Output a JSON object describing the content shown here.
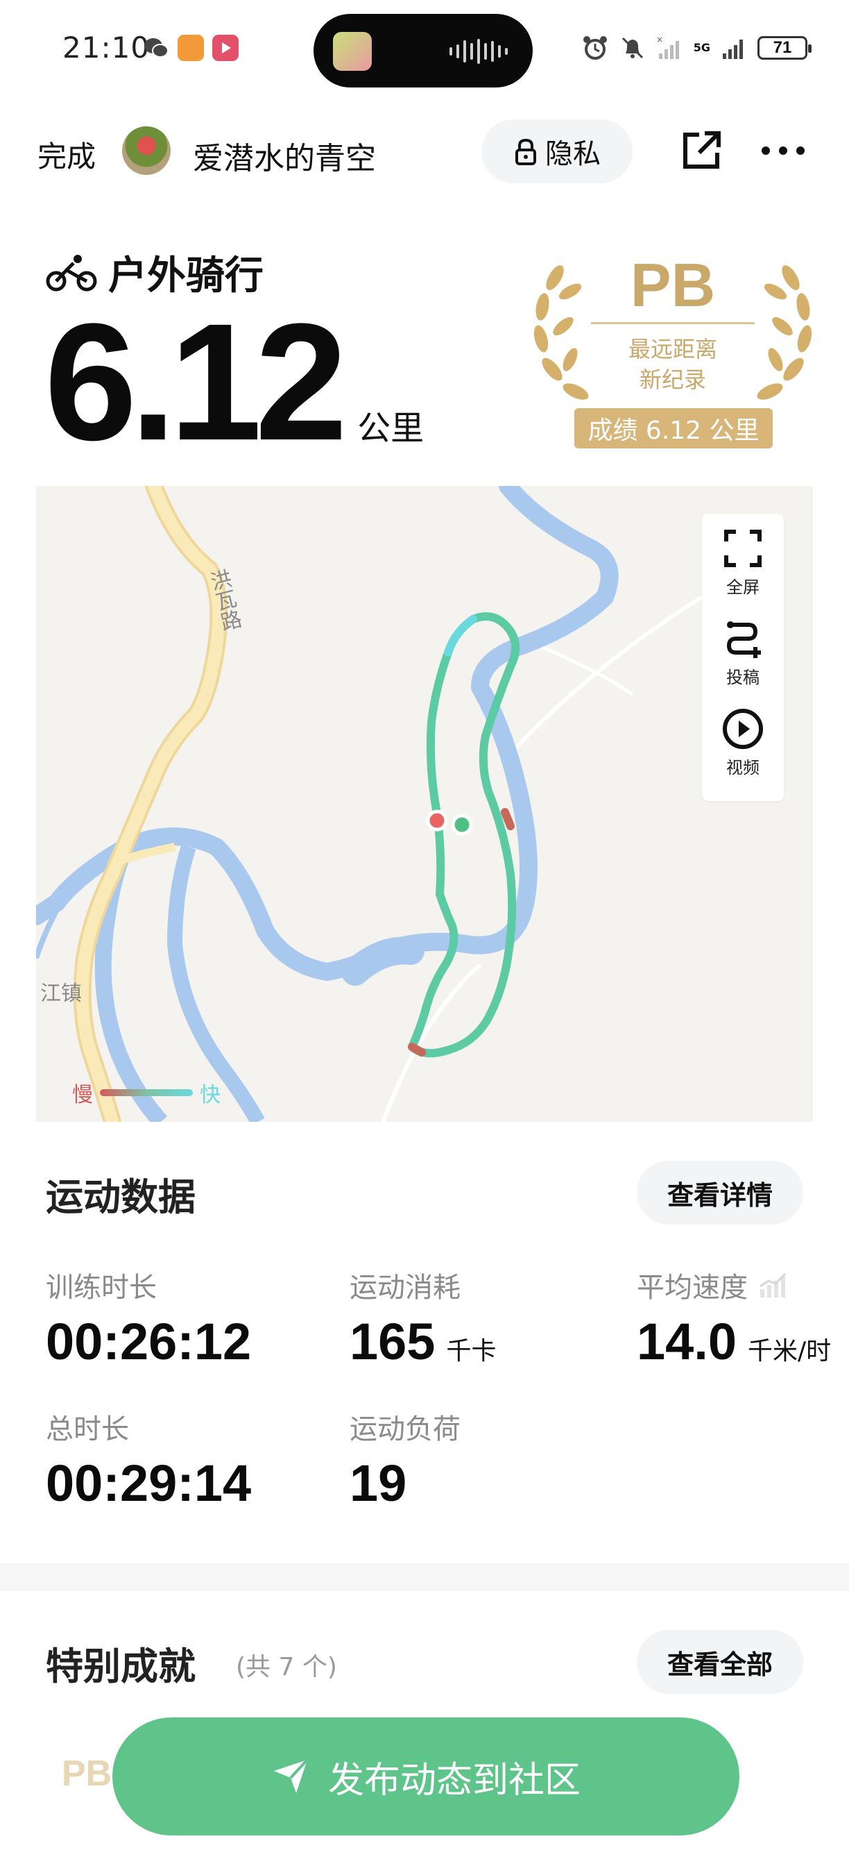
{
  "status_bar": {
    "time": "21:10",
    "battery": "71",
    "network": "5G",
    "apps": [
      "wechat-icon",
      "chat-bubble-app-icon",
      "video-app-icon"
    ],
    "indicators": [
      "alarm-icon",
      "mute-bell-icon",
      "no-signal-icon",
      "cell-signal-icon"
    ]
  },
  "header": {
    "done_label": "完成",
    "username": "爱潜水的青空",
    "privacy_label": "隐私",
    "icons": [
      "share-icon",
      "more-icon"
    ]
  },
  "activity": {
    "type_label": "户外骑行",
    "distance_value": "6.12",
    "distance_unit": "公里"
  },
  "pb_badge": {
    "title": "PB",
    "line1": "最远距离",
    "line2": "新纪录",
    "score": "成绩 6.12 公里"
  },
  "map": {
    "road_label": "洪瓦路",
    "town_label": "江镇",
    "tools": {
      "fullscreen": "全屏",
      "submit": "投稿",
      "video": "视频"
    },
    "legend_slow": "慢",
    "legend_fast": "快",
    "colors": {
      "river": "#a9c8ee",
      "road": "#f7e2a6",
      "route": "#5ccaa4",
      "start_dot": "#ea6464",
      "end_dot": "#4fbf86"
    }
  },
  "stats": {
    "title": "运动数据",
    "details_button": "查看详情",
    "items": [
      {
        "label": "训练时长",
        "value": "00:26:12",
        "unit": ""
      },
      {
        "label": "运动消耗",
        "value": "165",
        "unit": "千卡"
      },
      {
        "label": "平均速度",
        "value": "14.0",
        "unit": "千米/时"
      },
      {
        "label": "总时长",
        "value": "00:29:14",
        "unit": ""
      },
      {
        "label": "运动负荷",
        "value": "19",
        "unit": ""
      }
    ]
  },
  "achievements": {
    "title": "特别成就",
    "count_text": "(共 7 个)",
    "view_all_button": "查看全部",
    "first_badge": "PB"
  },
  "publish_button": "发布动态到社区",
  "theme": {
    "accent_green": "#5ec48a",
    "pb_gold": "#d8b578"
  }
}
